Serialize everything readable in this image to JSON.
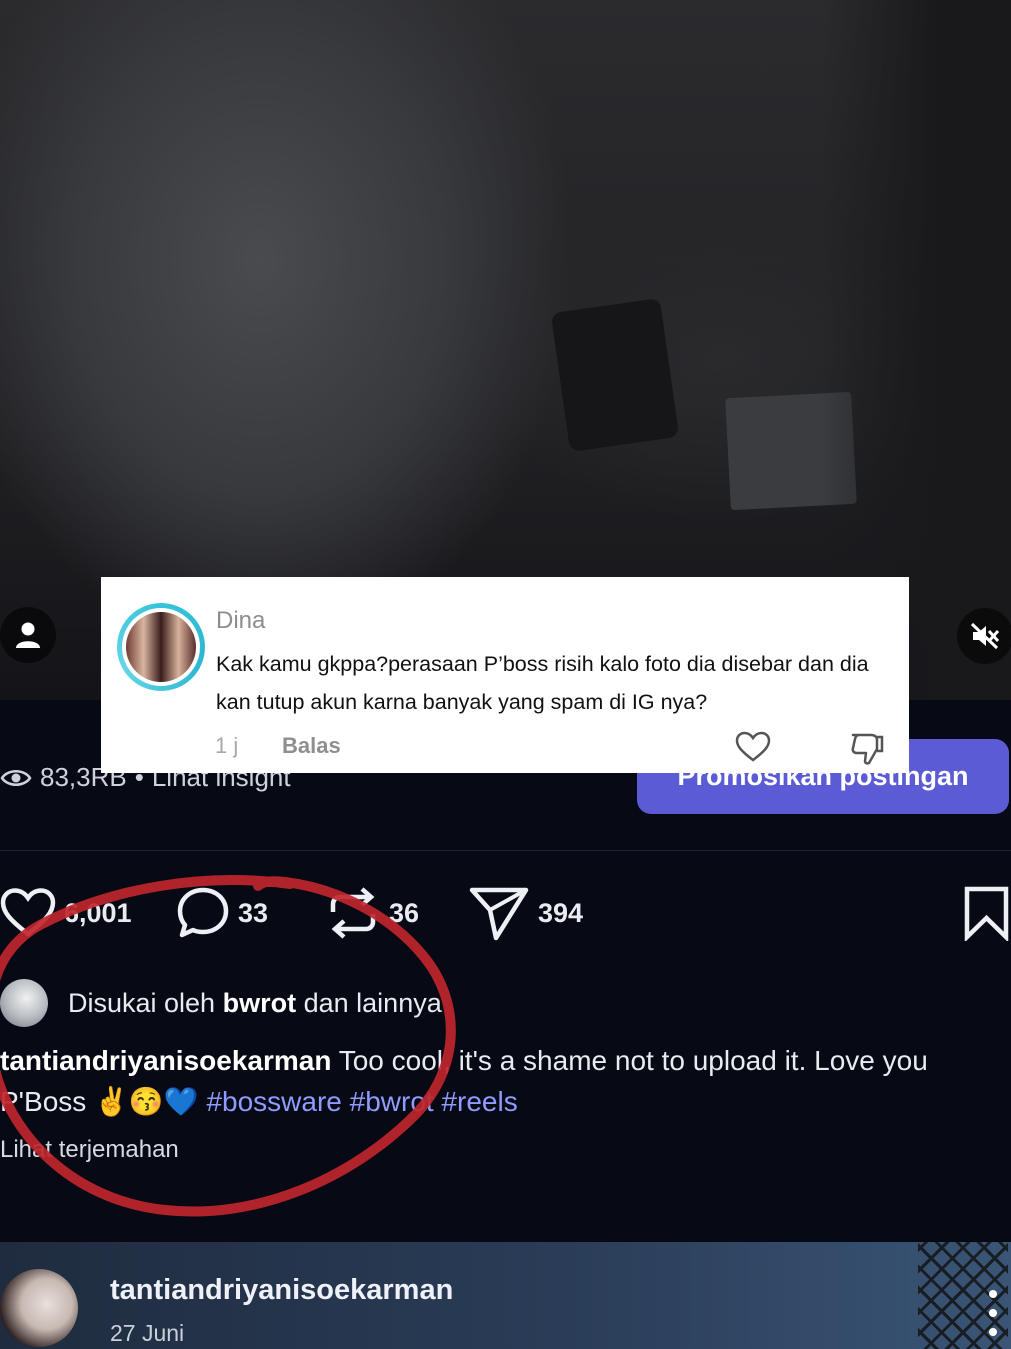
{
  "comment": {
    "username": "Dina",
    "text": "Kak kamu gkppa?perasaan P’boss risih kalo foto dia disebar dan dia kan tutup akun karna banyak yang spam di IG nya?",
    "time": "1 j",
    "reply_label": "Balas"
  },
  "insights": {
    "views": "83,3RB",
    "separator": "•",
    "link_label": "Lihat insight"
  },
  "promote_label": "Promosikan postingan",
  "actions": {
    "likes": "6,001",
    "comments": "33",
    "reposts": "36",
    "shares": "394"
  },
  "liked_by": {
    "prefix": "Disukai oleh",
    "user": "bwrot",
    "suffix": "dan lainnya"
  },
  "caption": {
    "author": "tantiandriyanisoekarman",
    "text": "Too cool, it's a shame not to upload it. Love you P'Boss",
    "emojis": "✌😚💙",
    "hashtags": "#bossware #bwrot #reels"
  },
  "translate_label": "Lihat terjemahan",
  "next_post": {
    "username": "tantiandriyanisoekarman",
    "date": "27 Juni"
  },
  "colors": {
    "accent_button": "#5b5bd6",
    "hashtag": "#8f9bff",
    "annotation_circle": "#c0262e",
    "avatar_ring": "#36c3d9"
  }
}
